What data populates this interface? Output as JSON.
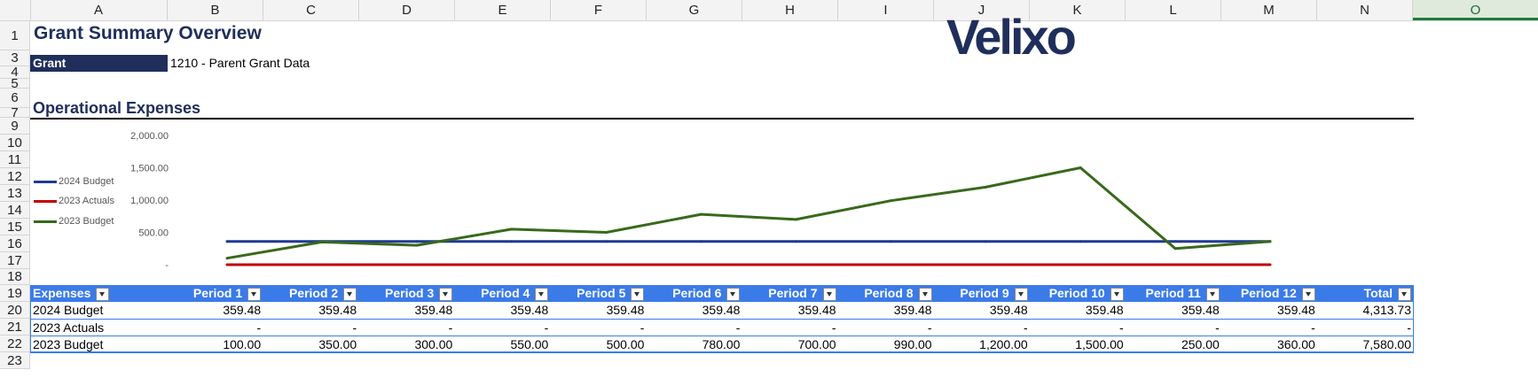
{
  "column_headers": [
    "A",
    "B",
    "C",
    "D",
    "E",
    "F",
    "G",
    "H",
    "I",
    "J",
    "K",
    "L",
    "M",
    "N",
    "O"
  ],
  "row_headers": [
    "1",
    "3",
    "4",
    "5",
    "6",
    "7",
    "9",
    "10",
    "11",
    "12",
    "13",
    "14",
    "15",
    "16",
    "17",
    "18",
    "19",
    "20",
    "21",
    "22",
    "23"
  ],
  "title": "Grant Summary Overview",
  "logo": "Velixo",
  "grant": {
    "label": "Grant",
    "value": "1210 - Parent Grant Data"
  },
  "section_title": "Operational Expenses",
  "chart_data": {
    "type": "line",
    "categories": [
      "Period 1",
      "Period 2",
      "Period 3",
      "Period 4",
      "Period 5",
      "Period 6",
      "Period 7",
      "Period 8",
      "Period 9",
      "Period 10",
      "Period 11",
      "Period 12"
    ],
    "y_ticks": [
      "-",
      "500.00",
      "1,000.00",
      "1,500.00",
      "2,000.00"
    ],
    "ylim": [
      0,
      2000
    ],
    "legend_position": "left",
    "series": [
      {
        "name": "2024 Budget",
        "color": "#1f3a93",
        "values": [
          359.48,
          359.48,
          359.48,
          359.48,
          359.48,
          359.48,
          359.48,
          359.48,
          359.48,
          359.48,
          359.48,
          359.48
        ]
      },
      {
        "name": "2023 Actuals",
        "color": "#c00000",
        "values": [
          0,
          0,
          0,
          0,
          0,
          0,
          0,
          0,
          0,
          0,
          0,
          0
        ]
      },
      {
        "name": "2023 Budget",
        "color": "#38691b",
        "values": [
          100,
          350,
          300,
          550,
          500,
          780,
          700,
          990,
          1200,
          1500,
          250,
          360
        ]
      }
    ]
  },
  "table": {
    "headers": [
      "Expenses",
      "Period 1",
      "Period 2",
      "Period 3",
      "Period 4",
      "Period 5",
      "Period 6",
      "Period 7",
      "Period 8",
      "Period 9",
      "Period 10",
      "Period 11",
      "Period 12",
      "Total"
    ],
    "rows": [
      [
        "2024 Budget",
        "359.48",
        "359.48",
        "359.48",
        "359.48",
        "359.48",
        "359.48",
        "359.48",
        "359.48",
        "359.48",
        "359.48",
        "359.48",
        "359.48",
        "4,313.73"
      ],
      [
        "2023 Actuals",
        "-",
        "-",
        "-",
        "-",
        "-",
        "-",
        "-",
        "-",
        "-",
        "-",
        "-",
        "-",
        "-"
      ],
      [
        "2023 Budget",
        "100.00",
        "350.00",
        "300.00",
        "550.00",
        "500.00",
        "780.00",
        "700.00",
        "990.00",
        "1,200.00",
        "1,500.00",
        "250.00",
        "360.00",
        "7,580.00"
      ]
    ]
  }
}
